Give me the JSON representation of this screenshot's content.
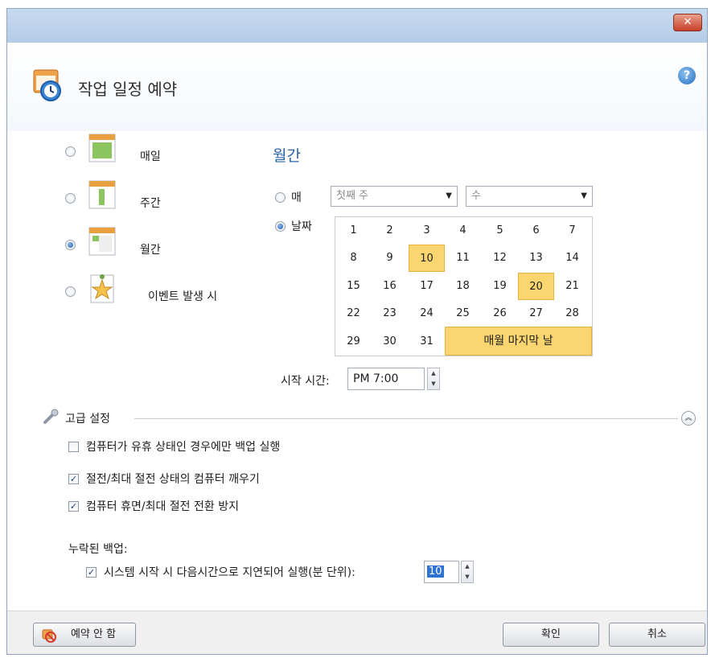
{
  "window": {
    "close_glyph": "✕"
  },
  "header": {
    "title": "작업 일정 예약",
    "help_glyph": "?"
  },
  "schedule_types": [
    {
      "label": "매일",
      "selected": false
    },
    {
      "label": "주간",
      "selected": false
    },
    {
      "label": "월간",
      "selected": true
    },
    {
      "label": "이벤트 발생 시",
      "selected": false
    }
  ],
  "monthly": {
    "section_title": "월간",
    "every_option": {
      "label": "매",
      "selected": false,
      "week_value": "첫째 주",
      "day_value": "수"
    },
    "date_option": {
      "label": "날짜",
      "selected": true
    },
    "calendar": {
      "days": [
        1,
        2,
        3,
        4,
        5,
        6,
        7,
        8,
        9,
        10,
        11,
        12,
        13,
        14,
        15,
        16,
        17,
        18,
        19,
        20,
        21,
        22,
        23,
        24,
        25,
        26,
        27,
        28,
        29,
        30,
        31
      ],
      "selected_days": [
        10,
        20
      ],
      "last_day_label": "매월 마지막 날",
      "last_day_selected": true
    },
    "start_time_label": "시작 시간:",
    "start_time_value": "PM 7:00"
  },
  "advanced": {
    "label": "고급 설정",
    "collapse_glyph": "︽",
    "options": [
      {
        "label": "컴퓨터가 유휴 상태인 경우에만 백업 실행",
        "checked": false
      },
      {
        "label": "절전/최대 절전 상태의 컴퓨터 깨우기",
        "checked": true
      },
      {
        "label": "컴퓨터 휴면/최대 절전 전환 방지",
        "checked": true
      }
    ],
    "missed_label": "누락된 백업:",
    "delay_option": {
      "label": "시스템 시작 시 다음시간으로 지연되어 실행(분 단위):",
      "checked": true,
      "value": "10"
    }
  },
  "footer": {
    "no_schedule_label": "예약 안 함",
    "ok_label": "확인",
    "cancel_label": "취소"
  },
  "colors": {
    "accent_title": "#2a64a8",
    "selection": "#fbd56f"
  }
}
